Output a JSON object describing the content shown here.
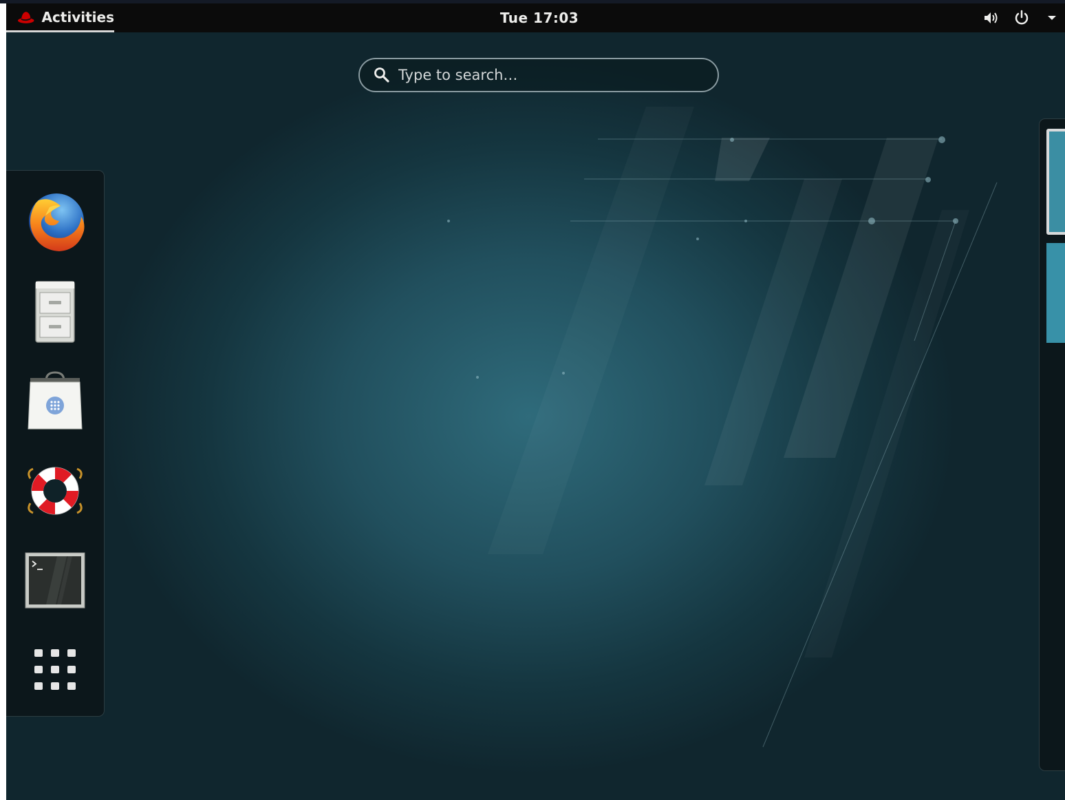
{
  "topbar": {
    "activities_label": "Activities",
    "clock": "Tue 17:03",
    "tray": [
      "volume-icon",
      "power-icon",
      "dropdown-arrow-icon"
    ]
  },
  "search": {
    "placeholder": "Type to search…",
    "value": ""
  },
  "dash": {
    "apps": [
      {
        "icon": "firefox-icon"
      },
      {
        "icon": "files-icon"
      },
      {
        "icon": "software-icon"
      },
      {
        "icon": "help-icon"
      },
      {
        "icon": "terminal-icon"
      },
      {
        "icon": "show-applications-icon"
      }
    ]
  },
  "workspaces": {
    "count": 2,
    "active": 1
  },
  "colors": {
    "topbar": "#0b0b0b",
    "wallpaper_center": "#2f6b7b",
    "wallpaper_edge": "#10262e",
    "workspace": "#3b8ea3"
  }
}
